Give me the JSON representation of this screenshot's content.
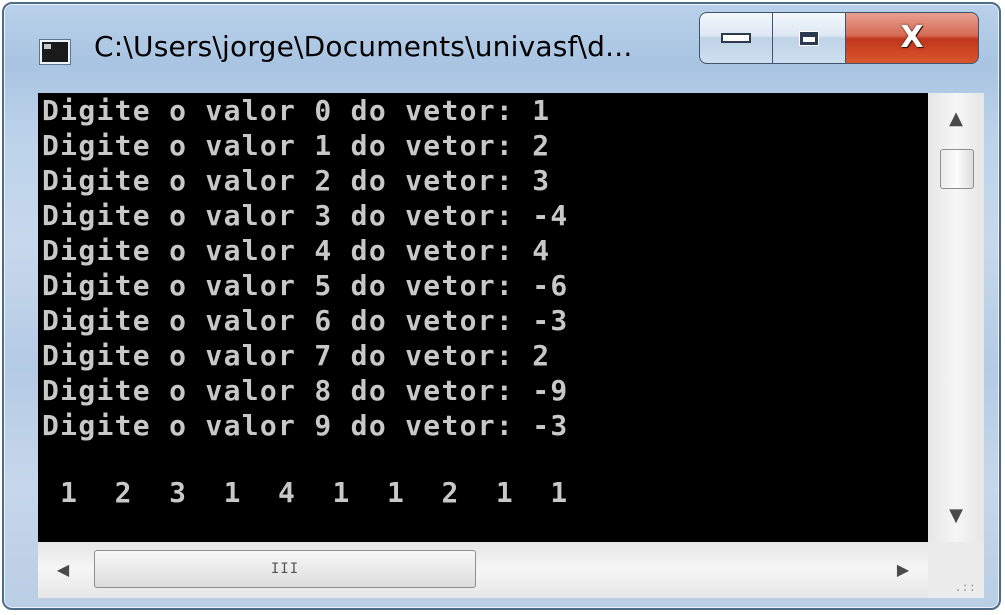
{
  "window": {
    "title": "C:\\Users\\jorge\\Documents\\univasf\\d...",
    "minimize_glyph": "",
    "close_glyph": "X",
    "accent_close": "#c0361c",
    "frame_color": "#b9d1ea"
  },
  "console": {
    "background": "#000000",
    "text_color": "#c8c8c8",
    "lines": [
      "Digite o valor 0 do vetor: 1",
      "Digite o valor 1 do vetor: 2",
      "Digite o valor 2 do vetor: 3",
      "Digite o valor 3 do vetor: -4",
      "Digite o valor 4 do vetor: 4",
      "Digite o valor 5 do vetor: -6",
      "Digite o valor 6 do vetor: -3",
      "Digite o valor 7 do vetor: 2",
      "Digite o valor 8 do vetor: -9",
      "Digite o valor 9 do vetor: -3",
      "",
      " 1  2  3  1  4  1  1  2  1  1"
    ]
  },
  "scrollbars": {
    "up_arrow": "▲",
    "down_arrow": "▼",
    "left_arrow": "◀",
    "right_arrow": "▶",
    "h_grip": "III",
    "resize_grip": ".::"
  }
}
